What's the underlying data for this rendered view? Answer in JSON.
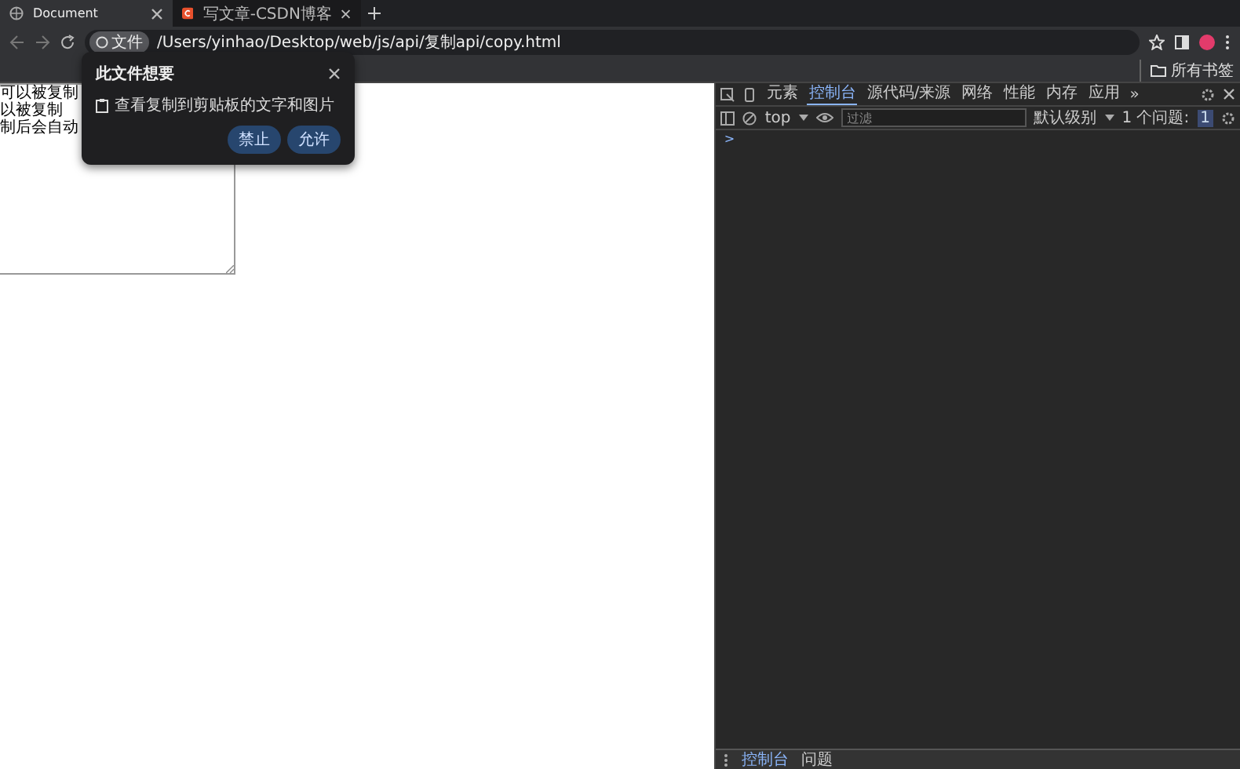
{
  "browser_tabs": [
    {
      "title": "Document",
      "selected": true
    },
    {
      "title": "写文章-CSDN博客",
      "selected": false
    }
  ],
  "address_bar": {
    "chip": "文件",
    "url": "/Users/yinhao/Desktop/web/js/api/复制api/copy.html"
  },
  "bookmarks_bar": {
    "all_bookmarks": "所有书签"
  },
  "page": {
    "text_lines": [
      "可以被复制",
      "以被复制",
      "制后会自动"
    ]
  },
  "permission_popup": {
    "title": "此文件想要",
    "permission": "查看复制到剪贴板的文字和图片",
    "buttons": [
      "禁止",
      "允许"
    ]
  },
  "devtools": {
    "tabs": [
      {
        "label": "元素",
        "selected": false
      },
      {
        "label": "控制台",
        "selected": true
      },
      {
        "label": "源代码/来源",
        "selected": false
      },
      {
        "label": "网络",
        "selected": false
      },
      {
        "label": "性能",
        "selected": false
      },
      {
        "label": "内存",
        "selected": false
      },
      {
        "label": "应用",
        "selected": false
      }
    ],
    "more": "»",
    "context": "top",
    "filter": {
      "placeholder": "过滤"
    },
    "levels": "默认级别",
    "issues_label": "1 个问题:",
    "issues_count": "1",
    "prompt": ">",
    "drawer_tabs": [
      {
        "label": "控制台",
        "selected": true
      },
      {
        "label": "问题",
        "selected": false
      }
    ]
  }
}
